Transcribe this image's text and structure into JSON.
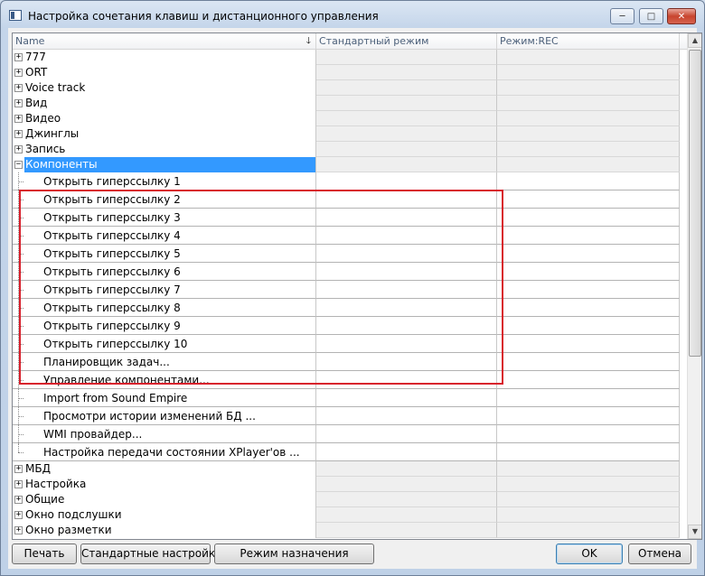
{
  "window": {
    "title": "Настройка сочетания клавиш и дистанционного управления",
    "controls": {
      "minimize": "─",
      "maximize": "□",
      "close": "✕"
    }
  },
  "grid": {
    "columns": [
      "Name",
      "Стандартный режим",
      "Режим:REC"
    ],
    "sort_indicator": "🡓",
    "groups_before": [
      {
        "label": "777",
        "expander": "+"
      },
      {
        "label": "ORT",
        "expander": "+"
      },
      {
        "label": "Voice track",
        "expander": "+"
      },
      {
        "label": "Вид",
        "expander": "+"
      },
      {
        "label": "Видео",
        "expander": "+"
      },
      {
        "label": "Джинглы",
        "expander": "+"
      },
      {
        "label": "Запись",
        "expander": "+"
      }
    ],
    "expanded_group": {
      "label": "Компоненты",
      "expander": "−"
    },
    "items": [
      "Открыть гиперссылку 1",
      "Открыть гиперссылку 2",
      "Открыть гиперссылку 3",
      "Открыть гиперссылку 4",
      "Открыть гиперссылку 5",
      "Открыть гиперссылку 6",
      "Открыть гиперссылку 7",
      "Открыть гиперссылку 8",
      "Открыть гиперссылку 9",
      "Открыть гиперссылку 10",
      "Планировщик задач...",
      "Управление компонентами...",
      "Import from Sound Empire",
      "Просмотри истории изменений БД ...",
      "WMI провайдер...",
      "Настройка передачи состоянии XPlayer'ов ..."
    ],
    "groups_after": [
      {
        "label": "МБД",
        "expander": "+"
      },
      {
        "label": "Настройка",
        "expander": "+"
      },
      {
        "label": "Общие",
        "expander": "+"
      },
      {
        "label": "Окно подслушки",
        "expander": "+"
      },
      {
        "label": "Окно разметки",
        "expander": "+"
      }
    ],
    "highlight_color": "#d8202c",
    "selection_color": "#3399ff",
    "scroll": {
      "up": "▲",
      "down": "▼"
    }
  },
  "buttons": {
    "print": "Печать",
    "defaults": "Стандартные настройки",
    "assign_mode": "Режим назначения",
    "ok": "OK",
    "cancel": "Отмена"
  }
}
